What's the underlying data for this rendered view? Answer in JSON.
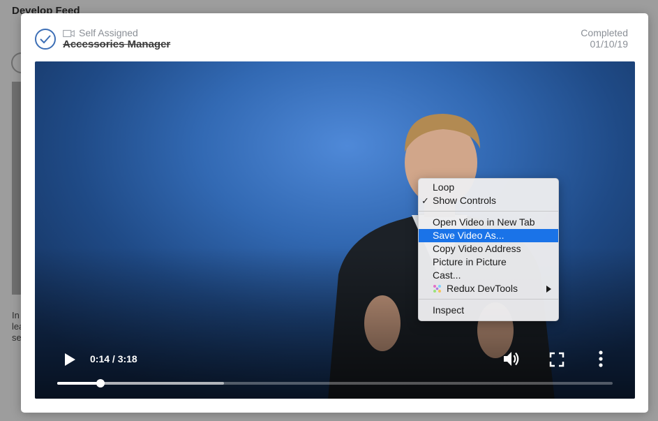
{
  "background_page": {
    "title": "Develop Feed",
    "snippet_lines": [
      "In",
      "lea",
      "se"
    ]
  },
  "modal": {
    "assignment_type": "Self Assigned",
    "module_title": "Accessories Manager",
    "status_label": "Completed",
    "status_date": "01/10/19",
    "accent_color": "#3d6fb6"
  },
  "video": {
    "time_display": "0:14 / 3:18",
    "played_fraction": 0.078,
    "buffered_fraction": 0.3,
    "icons": {
      "play": "play-icon",
      "volume": "volume-icon",
      "fullscreen": "fullscreen-icon",
      "more": "more-vertical-icon"
    }
  },
  "context_menu": {
    "items": [
      {
        "label": "Loop",
        "checked": false
      },
      {
        "label": "Show Controls",
        "checked": true
      },
      {
        "label": "Open Video in New Tab"
      },
      {
        "label": "Save Video As...",
        "highlighted": true
      },
      {
        "label": "Copy Video Address"
      },
      {
        "label": "Picture in Picture"
      },
      {
        "label": "Cast..."
      },
      {
        "label": "Redux DevTools",
        "submenu": true,
        "icon": "redux-icon"
      },
      {
        "label": "Inspect"
      }
    ],
    "check_glyph": "✓",
    "highlight_color": "#1a73e8"
  }
}
